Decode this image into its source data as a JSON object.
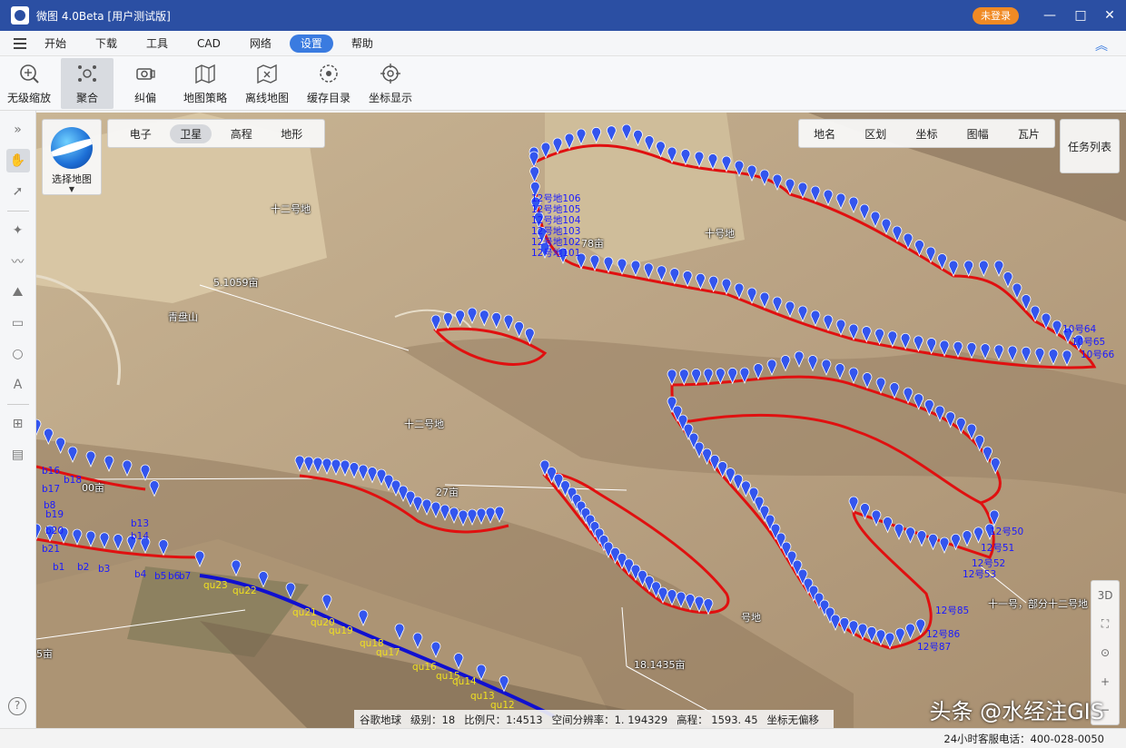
{
  "window": {
    "title": "微图 4.0Beta [用户测试版]",
    "login_badge": "未登录",
    "minimize": "—",
    "maximize": "□",
    "close": "✕"
  },
  "menu": {
    "items": [
      "开始",
      "下载",
      "工具",
      "CAD",
      "网络",
      "设置",
      "帮助"
    ],
    "active": "设置",
    "collapse": "︽"
  },
  "toolbar": {
    "tools": [
      {
        "label": "无级缩放",
        "icon": "zoom-icon"
      },
      {
        "label": "聚合",
        "icon": "cluster-icon",
        "active": true
      },
      {
        "label": "纠偏",
        "icon": "correct-icon"
      },
      {
        "label": "地图策略",
        "icon": "map-strategy-icon"
      },
      {
        "label": "离线地图",
        "icon": "offline-map-icon"
      },
      {
        "label": "缓存目录",
        "icon": "cache-dir-icon"
      },
      {
        "label": "坐标显示",
        "icon": "coord-display-icon"
      }
    ]
  },
  "left_tools": [
    "expand-icon",
    "hand-icon",
    "select-arrow-icon",
    "polygon-icon",
    "polyline-icon",
    "area-icon",
    "rectangle-icon",
    "circle-icon",
    "text-icon",
    "measure-icon",
    "ruler-icon"
  ],
  "map_controls": {
    "select_map_label": "选择地图",
    "map_types": [
      "电子",
      "卫星",
      "高程",
      "地形"
    ],
    "active_map_type": "卫星",
    "overlays": [
      "地名",
      "区划",
      "坐标",
      "图幅",
      "瓦片"
    ],
    "task_list": "任务列表",
    "side": [
      "3D",
      "⛶",
      "⊙",
      "+",
      "−"
    ]
  },
  "map_labels": {
    "twelve_top": "十二号地",
    "ten": "十号地",
    "area_5": "5.1059亩",
    "qinpan": "青盘山",
    "twelve_mid": "十二号地",
    "area_78": "78亩",
    "area_18": "18.1435亩",
    "eleven_twelve": "十一号，部分十二号地",
    "area_00": "00亩",
    "area_27": "27亩",
    "left_5": "5亩",
    "hao_di": "号地"
  },
  "point_labels": {
    "b_points": [
      "b1",
      "b2",
      "b3",
      "b4",
      "b5",
      "b6",
      "b7",
      "b8",
      "b19",
      "b20",
      "b21",
      "b16",
      "b17",
      "b18",
      "b13",
      "b14"
    ],
    "qu_points": [
      "qu23",
      "qu22",
      "qu21",
      "qu20",
      "qu19",
      "qu18",
      "qu17",
      "qu16",
      "qu15",
      "qu14",
      "qu13",
      "qu12"
    ],
    "twelve_left": [
      "12号地106",
      "12号地105",
      "12号地104",
      "12号地103",
      "12号地102",
      "12号地101"
    ],
    "twelve_right": [
      "12号50",
      "12号51",
      "12号52",
      "12号53",
      "12号85",
      "12号86",
      "12号87"
    ],
    "ten_right": [
      "10号64",
      "10号65",
      "10号66"
    ]
  },
  "status": {
    "source": "谷歌地球",
    "level": "级别：18",
    "scale": "比例尺：1:4513",
    "resolution": "空间分辨率：1. 194329",
    "elevation": "高程：  1593. 45",
    "coord": "坐标无偏移"
  },
  "watermark": "头条 @水经注GIS",
  "hotline": "24小时客服电话：400-028-0050",
  "colors": {
    "titlebar": "#2b4fa3",
    "accent": "#3a7be0",
    "login": "#f08a24",
    "pin": "#3355ee",
    "boundary_red": "#e01010",
    "road_blue": "#1010d0"
  }
}
